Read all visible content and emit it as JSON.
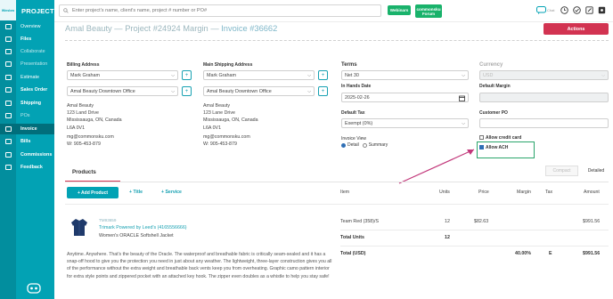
{
  "sidebar": {
    "brand": "Winslow",
    "title": "PROJECT",
    "items": [
      {
        "label": "Overview",
        "icon": "dashboard-icon"
      },
      {
        "label": "Files",
        "icon": "folder-icon"
      },
      {
        "label": "Collaborate",
        "icon": "chat-icon"
      },
      {
        "label": "Presentation",
        "icon": "presentation-icon"
      },
      {
        "label": "Estimate",
        "icon": "calculator-icon"
      },
      {
        "label": "Sales Order",
        "icon": "cart-icon"
      },
      {
        "label": "Shipping",
        "icon": "truck-icon"
      },
      {
        "label": "POs",
        "icon": "document-icon"
      },
      {
        "label": "Invoice",
        "icon": "invoice-icon"
      },
      {
        "label": "Bills",
        "icon": "bill-icon"
      },
      {
        "label": "Commissions",
        "icon": "percent-icon"
      },
      {
        "label": "Feedback",
        "icon": "feedback-icon"
      }
    ],
    "active": "Invoice"
  },
  "topbar": {
    "search_placeholder": "Enter project's name, client's name, project # number or PO#",
    "webinars": "Webinars",
    "community_l1": "commonsku",
    "community_l2": "Forum",
    "chat_badge": "Chat"
  },
  "header": {
    "client": "Amal Beauty",
    "project": "Project #24924 Margin",
    "sep": " — ",
    "invoice": "Invoice #36662",
    "actions": "Actions"
  },
  "billing": {
    "label": "Billing Address",
    "contact": "Mark Graham",
    "address_select": "Amal Beauty Downtown Office",
    "lines": [
      "Amal Beauty",
      "123 Land Drive",
      "Mississauga, ON, Canada",
      "L6A 0V1",
      "",
      "mg@commonsku.com",
      "W: 905-453-879"
    ]
  },
  "shipping": {
    "label": "Main Shipping Address",
    "contact": "Mark Graham",
    "address_select": "Amal Beauty Downtown Office",
    "lines": [
      "Amal Beauty",
      "123 Lane Drive",
      "Mississauga, ON, Canada",
      "L6A 0V1",
      "",
      "mg@commonsku.com",
      "W: 905-453-879"
    ]
  },
  "terms": {
    "label": "Terms",
    "value": "Net 30",
    "in_hands_label": "In Hands Date",
    "in_hands_value": "2025-02-26",
    "tax_label": "Default Tax",
    "tax_value": "Exempt (0%)",
    "invoice_view_label": "Invoice View",
    "view_detail": "Detail",
    "view_summary": "Summary"
  },
  "currency": {
    "label": "Currency",
    "value": "USD",
    "margin_label": "Default Margin",
    "po_label": "Customer PO",
    "allow_cc": "Allow credit card",
    "allow_ach": "Allow ACH"
  },
  "tabs": {
    "products": "Products",
    "compact": "Compact",
    "detailed": "Detailed"
  },
  "toolbar": {
    "add_product": "+ Add Product",
    "title": "+ Title",
    "service": "+ Service"
  },
  "columns": {
    "item": "Item",
    "units": "Units",
    "price": "Price",
    "margin": "Margin",
    "tax": "Tax",
    "amount": "Amount"
  },
  "product": {
    "sku": "TM93659",
    "supplier": "Trimark Powered by Leed's (4165556666)",
    "name": "Women's ORACLE Softshell Jacket",
    "row_item": "Team Red (358)/S",
    "row_units": "12",
    "row_price": "$82.63",
    "row_amount": "$991.56",
    "total_units_label": "Total Units",
    "total_units": "12",
    "total_label": "Total (USD)",
    "total_margin": "40.00%",
    "total_tax": "E",
    "total_amount": "$991.56",
    "description": "Anytime. Anywhere. That's the beauty of the Oracle. The waterproof and breathable fabric is critically seam-sealed and it has a snap-off hood to give you the protection you need in just about any weather. The lightweight, three-layer construction gives you all of the performance without the extra weight and breathable back vents keep you from overheating. Graphic camo pattern interior for extra style points and zippered pocket with an attached key hook. The zipper even doubles as a whistle to help you stay safe!"
  },
  "colors": {
    "teal": "#02a2b4",
    "red": "#d23351",
    "green": "#19b26b",
    "annotation": "#c2377a"
  }
}
